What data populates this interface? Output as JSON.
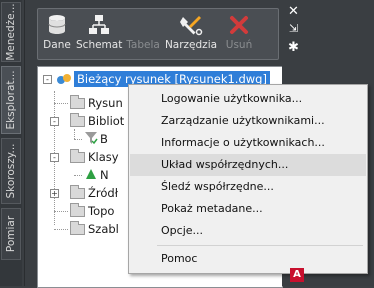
{
  "tabs": [
    "Menedże...",
    "Eksplorat...",
    "Skoroszy...",
    "Pomiar"
  ],
  "toolbar": {
    "buttons": [
      {
        "label": "Dane",
        "icon": "database-icon",
        "enabled": true
      },
      {
        "label": "Schemat",
        "icon": "schema-icon",
        "enabled": true
      },
      {
        "label": "Tabela",
        "icon": "table-icon",
        "enabled": false
      },
      {
        "label": "Narzędzia",
        "icon": "tools-icon",
        "enabled": true
      },
      {
        "label": "Usuń",
        "icon": "delete-icon",
        "enabled": false
      }
    ]
  },
  "tree": {
    "root": "Bieżący rysunek [Rysunek1.dwg]",
    "items": [
      "Rysun",
      "Bibliot",
      "B",
      "Klasy",
      "N",
      "Źródł",
      "Topo",
      "Szabl"
    ]
  },
  "menu": {
    "items": [
      "Logowanie użytkownika...",
      "Zarządzanie użytkownikami...",
      "Informacje o użytkownikach...",
      "Układ współrzędnych...",
      "Śledź współrzędne...",
      "Pokaż metadane...",
      "Opcje...",
      "Pomoc"
    ],
    "hover_index": 3
  },
  "colors": {
    "selection": "#2f7ed8",
    "delete": "#d23b3b",
    "brand": "#c8102e"
  },
  "brand_letter": "A"
}
